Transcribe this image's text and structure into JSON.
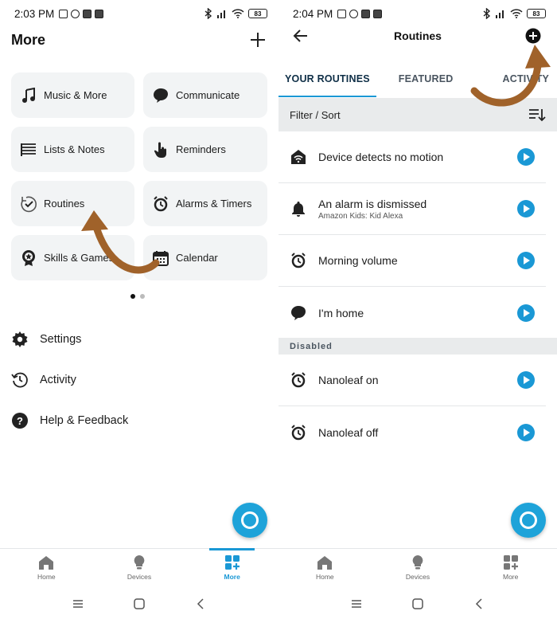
{
  "left": {
    "status": {
      "time": "2:03 PM",
      "battery": "83"
    },
    "title": "More",
    "tiles": [
      {
        "label": "Music & More",
        "icon": "music-note-icon"
      },
      {
        "label": "Communicate",
        "icon": "speech-bubble-icon"
      },
      {
        "label": "Lists & Notes",
        "icon": "list-icon"
      },
      {
        "label": "Reminders",
        "icon": "hand-pointer-icon"
      },
      {
        "label": "Routines",
        "icon": "routine-check-icon"
      },
      {
        "label": "Alarms & Timers",
        "icon": "alarm-clock-icon"
      },
      {
        "label": "Skills & Games",
        "icon": "skills-badge-icon"
      },
      {
        "label": "Calendar",
        "icon": "calendar-icon"
      }
    ],
    "menu": [
      {
        "label": "Settings",
        "icon": "gear-icon"
      },
      {
        "label": "Activity",
        "icon": "history-icon"
      },
      {
        "label": "Help & Feedback",
        "icon": "help-icon"
      }
    ],
    "nav": [
      {
        "label": "Home",
        "icon": "home-icon"
      },
      {
        "label": "Devices",
        "icon": "lightbulb-icon"
      },
      {
        "label": "More",
        "icon": "more-grid-icon",
        "active": true
      }
    ]
  },
  "right": {
    "status": {
      "time": "2:04 PM",
      "battery": "83"
    },
    "title": "Routines",
    "tabs": [
      {
        "label": "YOUR ROUTINES",
        "active": true
      },
      {
        "label": "FEATURED"
      },
      {
        "label": "ACTIVITY"
      }
    ],
    "filter_label": "Filter / Sort",
    "routines": [
      {
        "name": "Device detects no motion",
        "sub": "",
        "icon": "motion-sensor-icon"
      },
      {
        "name": "An alarm is dismissed",
        "sub": "Amazon Kids: Kid Alexa",
        "icon": "bell-icon"
      },
      {
        "name": "Morning volume",
        "sub": "",
        "icon": "alarm-clock-icon"
      },
      {
        "name": "I'm home",
        "sub": "",
        "icon": "speech-bubble-icon"
      }
    ],
    "disabled_label": "Disabled",
    "disabled_routines": [
      {
        "name": "Nanoleaf on",
        "icon": "alarm-clock-icon"
      },
      {
        "name": "Nanoleaf off",
        "icon": "alarm-clock-icon"
      }
    ],
    "nav": [
      {
        "label": "Home",
        "icon": "home-icon"
      },
      {
        "label": "Devices",
        "icon": "lightbulb-icon"
      },
      {
        "label": "More",
        "icon": "more-grid-icon"
      }
    ]
  },
  "colors": {
    "accent": "#1a98d5",
    "annotation_arrow": "#a0622a",
    "tile_bg": "#f2f4f5"
  }
}
